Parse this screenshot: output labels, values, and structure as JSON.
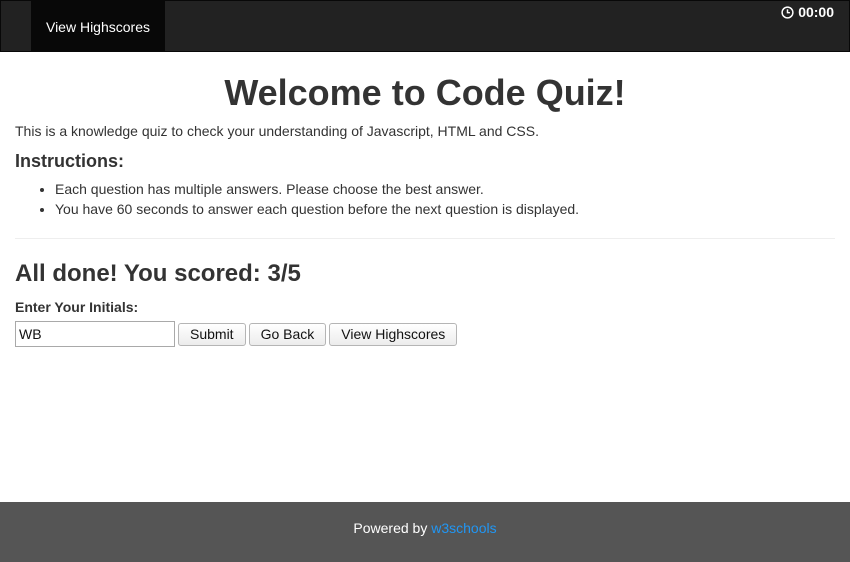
{
  "navbar": {
    "highscores_link": "View Highscores",
    "timer": "00:00"
  },
  "main": {
    "title": "Welcome to Code Quiz!",
    "intro": "This is a knowledge quiz to check your understanding of Javascript, HTML and CSS.",
    "instructions_heading": "Instructions:",
    "instructions": [
      "Each question has multiple answers. Please choose the best answer.",
      "You have 60 seconds to answer each question before the next question is displayed."
    ]
  },
  "result": {
    "score_text": "All done! You scored: 3/5",
    "initials_label": "Enter Your Initials:",
    "initials_value": "WB",
    "submit_label": "Submit",
    "go_back_label": "Go Back",
    "view_highscores_label": "View Highscores"
  },
  "footer": {
    "powered_by": "Powered by",
    "link_text": "w3schools"
  }
}
